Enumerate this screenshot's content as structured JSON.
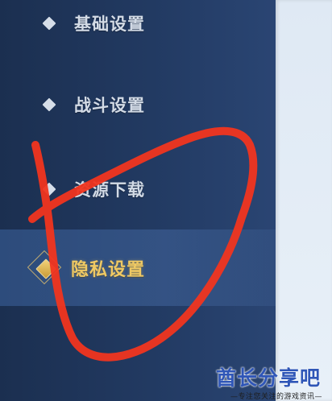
{
  "menu": {
    "items": [
      {
        "label": "基础设置",
        "icon": "diamond-bullet-icon",
        "selected": false
      },
      {
        "label": "战斗设置",
        "icon": "diamond-bullet-icon",
        "selected": false
      },
      {
        "label": "资源下载",
        "icon": "diamond-bullet-icon",
        "selected": false
      },
      {
        "label": "隐私设置",
        "icon": "diamond-bullet-selected-icon",
        "selected": true
      }
    ]
  },
  "colors": {
    "panel_bg": "#223a62",
    "item_text": "#d3dbe6",
    "selected_text": "#efc964",
    "selected_bg": "#3c64a0",
    "right_panel_bg": "#e4edf6",
    "annotation_stroke": "#f1351f",
    "watermark_blue": "#2f56b7"
  },
  "watermark": {
    "title": "酋长分享吧",
    "subtitle": "—专注您关注的游戏资讯—"
  }
}
